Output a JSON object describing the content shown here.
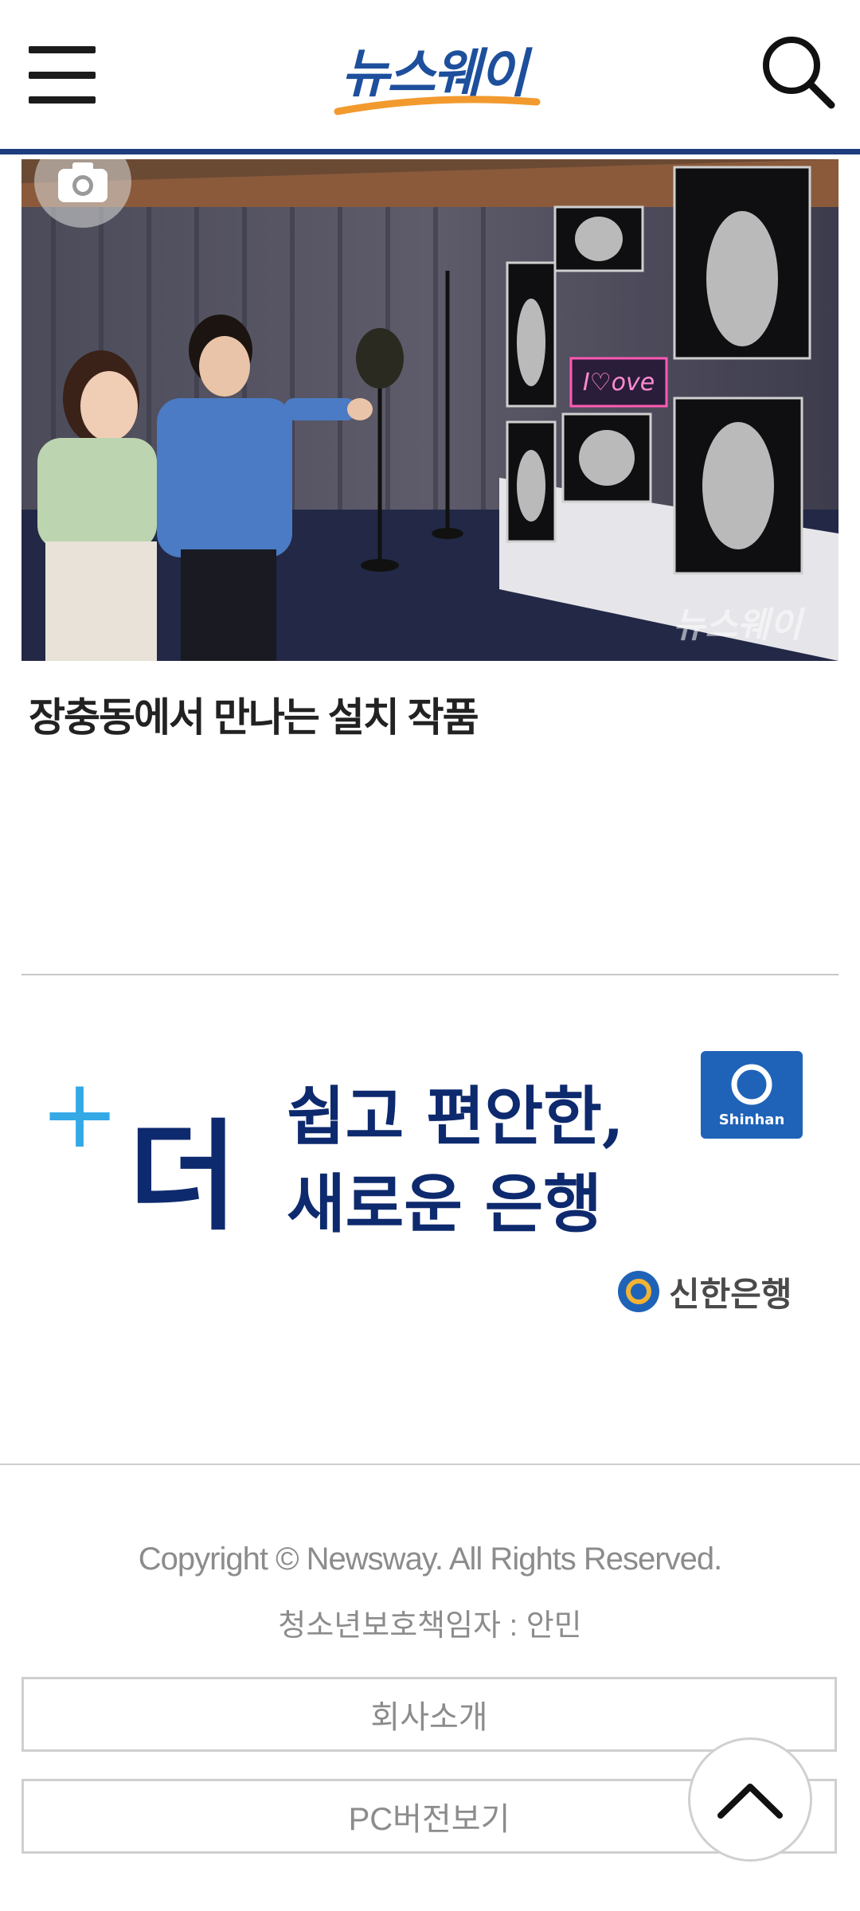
{
  "header": {
    "logo_text": "뉴스웨이",
    "menu_icon": "hamburger-menu-icon",
    "search_icon": "search-icon",
    "brand_color": "#1d3d7e",
    "accent_color": "#f29a2e"
  },
  "article": {
    "headline": "장충동에서 만나는 설치 작품",
    "photo_watermark": "뉴스웨이",
    "photo_sign_text": "I♡ove",
    "camera_icon": "camera-icon"
  },
  "ad": {
    "plus": "+",
    "big_char": "더",
    "line1": "쉽고 편안한,",
    "line2": "새로운 은행",
    "brand_badge": "Shinhan",
    "brand_name": "신한은행"
  },
  "footer": {
    "copyright": "Copyright © Newsway. All Rights Reserved.",
    "youth_officer": "청소년보호책임자 : 안민",
    "company_button": "회사소개",
    "pc_button": "PC버전보기",
    "top_icon": "chevron-up-icon"
  }
}
